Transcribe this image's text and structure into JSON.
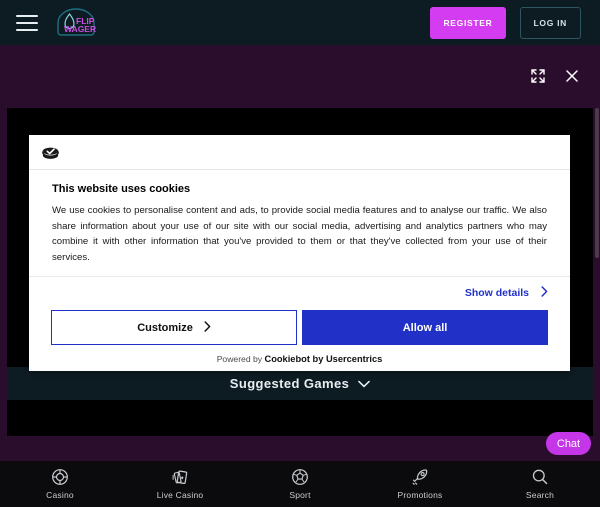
{
  "header": {
    "menu_icon": "hamburger-menu-icon",
    "logo_text_line1": "FLIP",
    "logo_text_line2": "WAGER",
    "register_label": "REGISTER",
    "login_label": "LOG IN",
    "register_color": "#d33cf0",
    "login_border_color": "#2f5561",
    "bar_color": "#0d1b22"
  },
  "window_controls": {
    "expand_icon": "expand-fullscreen-icon",
    "close_icon": "close-icon"
  },
  "overlay": {
    "band_color": "#2a0d2c",
    "content_color": "#000000"
  },
  "suggested": {
    "label": "Suggested Games",
    "chevron_icon": "chevron-down-icon"
  },
  "chat": {
    "label": "Chat",
    "color": "#c436e8"
  },
  "cookie": {
    "icon": "cookie-icon",
    "title": "This website uses cookies",
    "body": "We use cookies to personalise content and ads, to provide social media features and to analyse our traffic. We also share information about your use of our site with our social media, advertising and analytics partners who may combine it with other information that you've provided to them or that they've collected from your use of their services.",
    "show_details": "Show details",
    "show_details_icon": "chevron-right-icon",
    "customize_label": "Customize",
    "customize_icon": "chevron-right-icon",
    "allow_all_label": "Allow all",
    "powered_prefix": "Powered by",
    "powered_brand": "Cookiebot by Usercentrics",
    "link_color": "#2131c8"
  },
  "bottom_nav": {
    "items": [
      {
        "label": "Casino",
        "icon": "poker-chip-icon"
      },
      {
        "label": "Live Casino",
        "icon": "playing-cards-icon"
      },
      {
        "label": "Sport",
        "icon": "football-icon"
      },
      {
        "label": "Promotions",
        "icon": "rocket-icon"
      },
      {
        "label": "Search",
        "icon": "search-icon"
      }
    ]
  }
}
